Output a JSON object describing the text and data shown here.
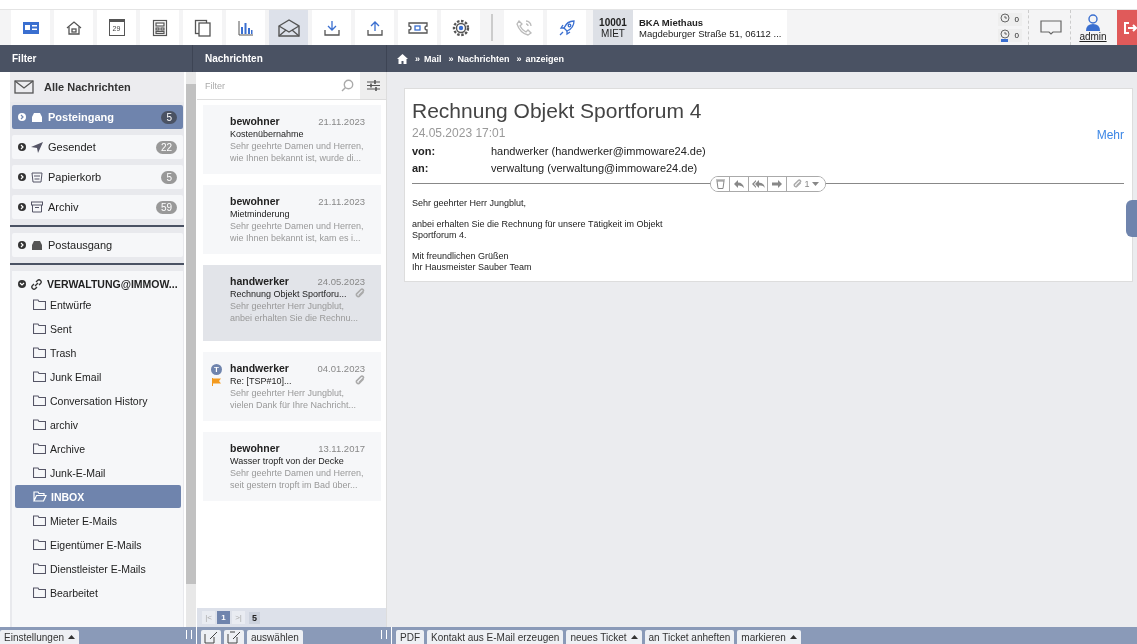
{
  "toolbar": {
    "icons": [
      {
        "kind": "card",
        "selected": false
      },
      {
        "kind": "house",
        "selected": false
      },
      {
        "kind": "calendar",
        "label": "29",
        "selected": false
      },
      {
        "kind": "form",
        "selected": false
      },
      {
        "kind": "pages",
        "selected": false
      },
      {
        "kind": "chart",
        "selected": false
      },
      {
        "kind": "mail",
        "selected": true
      },
      {
        "kind": "download",
        "selected": false
      },
      {
        "kind": "upload",
        "selected": false
      },
      {
        "kind": "ticket",
        "selected": false
      },
      {
        "kind": "gear",
        "selected": false
      }
    ],
    "extra_icons": [
      {
        "kind": "phone",
        "disabled": true
      },
      {
        "kind": "rocket",
        "disabled": false
      }
    ],
    "property": {
      "number": "10001",
      "type": "MIET",
      "name": "BKA Miethaus",
      "address": "Magdeburger Straße 51, 06112 ..."
    },
    "counters": [
      {
        "kind": "clock",
        "value": "0"
      },
      {
        "kind": "person-clock",
        "value": "0"
      }
    ],
    "user": "admin"
  },
  "headers": {
    "filter": "Filter",
    "messages": "Nachrichten",
    "breadcrumb": [
      {
        "separator": "»",
        "label": "Mail"
      },
      {
        "separator": "»",
        "label": "Nachrichten"
      },
      {
        "separator": "»",
        "label": "anzeigen"
      }
    ]
  },
  "filter": {
    "all": "Alle Nachrichten",
    "boxes": [
      {
        "kind": "inbox",
        "label": "Posteingang",
        "count": "5",
        "selected": true
      },
      {
        "kind": "sent",
        "label": "Gesendet",
        "count": "22",
        "selected": false
      },
      {
        "kind": "trash",
        "label": "Papierkorb",
        "count": "5",
        "selected": false
      },
      {
        "kind": "archive",
        "label": "Archiv",
        "count": "59",
        "selected": false
      }
    ],
    "outbox": "Postausgang",
    "account": {
      "label": "VERWALTUNG@IMMOW...",
      "expanded": true,
      "children": [
        {
          "label": "Entwürfe",
          "selected": false
        },
        {
          "label": "Sent",
          "selected": false
        },
        {
          "label": "Trash",
          "selected": false
        },
        {
          "label": "Junk Email",
          "selected": false
        },
        {
          "label": "Conversation History",
          "selected": false
        },
        {
          "label": "archiv",
          "selected": false
        },
        {
          "label": "Archive",
          "selected": false
        },
        {
          "label": "Junk-E-Mail",
          "selected": false
        },
        {
          "label": "INBOX",
          "selected": true
        },
        {
          "label": "Mieter E-Mails",
          "selected": false
        },
        {
          "label": "Eigentümer E-Mails",
          "selected": false
        },
        {
          "label": "Dienstleister E-Mails",
          "selected": false
        },
        {
          "label": "Bearbeitet",
          "selected": false
        }
      ]
    }
  },
  "list": {
    "placeholder": "Filter",
    "messages": [
      {
        "sender": "bewohner",
        "date": "21.11.2023",
        "subject": "Kostenübernahme",
        "preview": "Sehr geehrte Damen und Herren, wie Ihnen bekannt ist, wurde di...",
        "selected": false,
        "attachment": false,
        "flagged": false
      },
      {
        "sender": "bewohner",
        "date": "21.11.2023",
        "subject": "Mietminderung",
        "preview": "Sehr geehrte Damen und Herren, wie Ihnen bekannt ist, kam es i...",
        "selected": false,
        "attachment": false,
        "flagged": false
      },
      {
        "sender": "handwerker",
        "date": "24.05.2023",
        "subject": "Rechnung Objekt Sportforu...",
        "preview": "Sehr geehrter Herr Jungblut, anbei erhalten Sie die Rechnu...",
        "selected": true,
        "attachment": true,
        "flagged": false
      },
      {
        "sender": "handwerker",
        "date": "04.01.2023",
        "subject": "Re: [TSP#10]...",
        "preview": "Sehr geehrter Herr Jungblut, vielen Dank für Ihre Nachricht...",
        "selected": false,
        "attachment": true,
        "flagged": true,
        "avatar": "T"
      },
      {
        "sender": "bewohner",
        "date": "13.11.2017",
        "subject": "Wasser tropft von der Decke",
        "preview": "Sehr geehrte Damen und Herren, seit gestern tropft im Bad über...",
        "selected": false,
        "attachment": false,
        "flagged": false
      }
    ],
    "first": "|<",
    "pages": [
      {
        "label": "1",
        "selected": true
      }
    ],
    "last": ">|",
    "total": "5"
  },
  "mail": {
    "subject": "Rechnung Objekt Sportforum 4",
    "datetime": "24.05.2023 17:01",
    "more": "Mehr",
    "fields": [
      {
        "label": "von:",
        "value": "handwerker (handwerker@immoware24.de)"
      },
      {
        "label": "an:",
        "value": "verwaltung (verwaltung@immoware24.de)"
      }
    ],
    "attachments": "1",
    "body": [
      "Sehr geehrter Herr Jungblut,",
      "anbei erhalten Sie die Rechnung für unsere Tätigkeit im Objekt\nSportforum 4.",
      "Mit freundlichen Grüßen\nIhr Hausmeister Sauber Team"
    ]
  },
  "bottom": {
    "left": [
      "Einstellungen"
    ],
    "middle": [
      "auswählen"
    ],
    "right": [
      {
        "label": "PDF",
        "menu": false
      },
      {
        "label": "Kontakt aus E-Mail erzeugen",
        "menu": false
      },
      {
        "label": "neues Ticket",
        "menu": true
      },
      {
        "label": "an Ticket anheften",
        "menu": false
      },
      {
        "label": "markieren",
        "menu": true
      }
    ]
  }
}
